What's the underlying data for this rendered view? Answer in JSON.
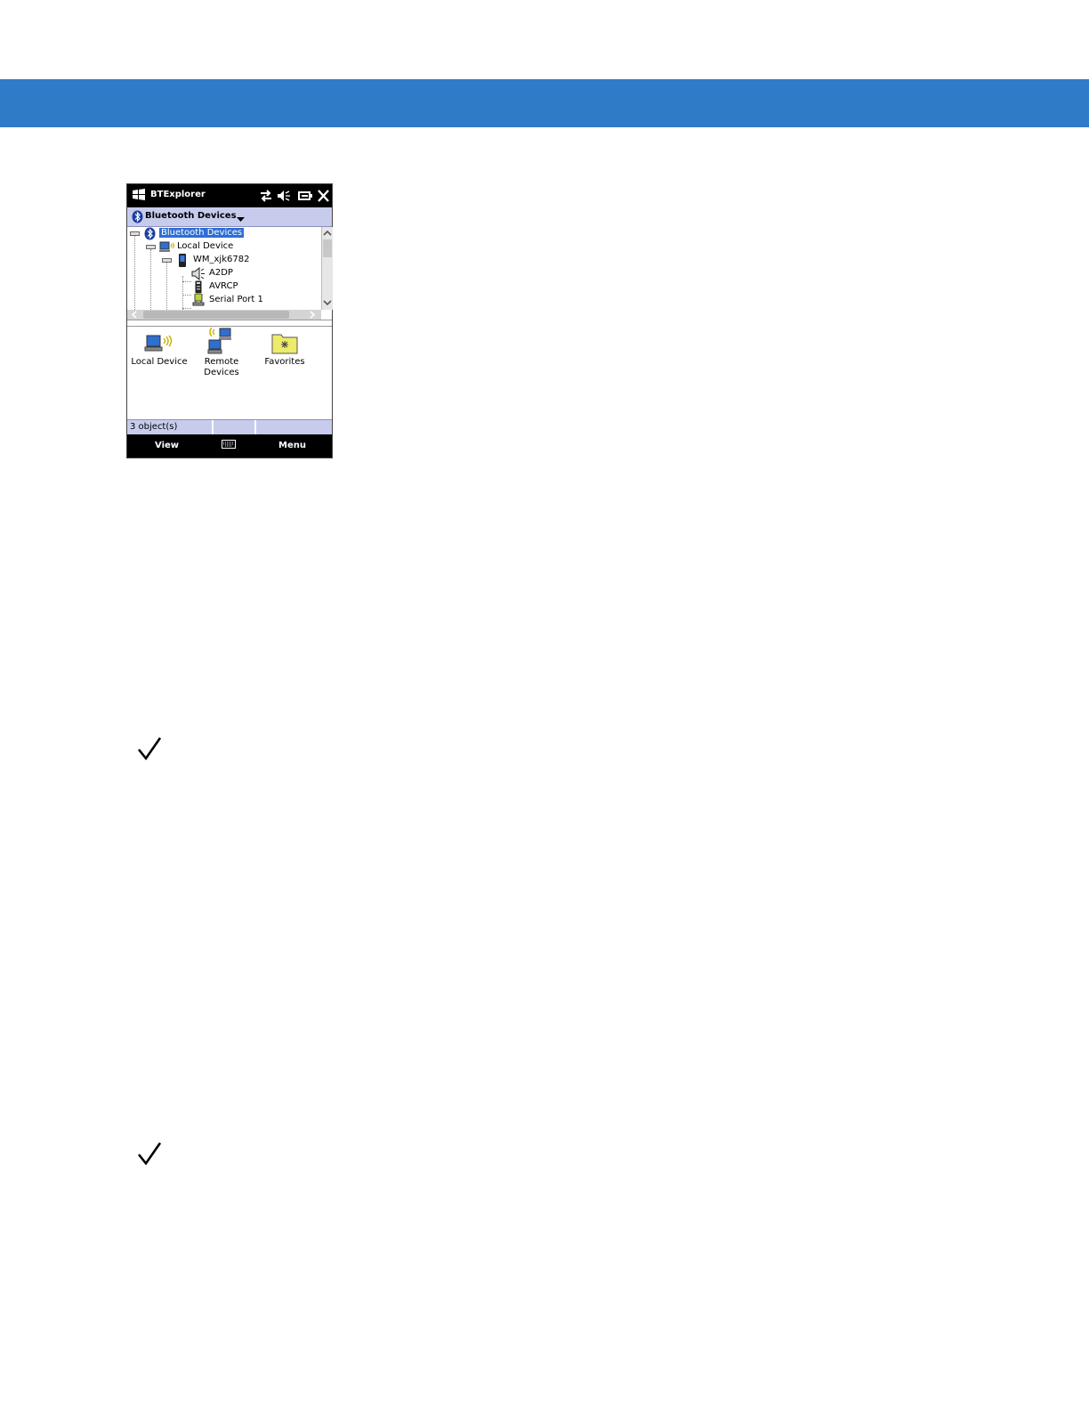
{
  "header_banner": {
    "color": "#2f7bc8"
  },
  "device_screen": {
    "titlebar": {
      "title": "BTExplorer",
      "icons": [
        "windows-start-icon",
        "connectivity-icon",
        "volume-icon",
        "battery-icon",
        "close-icon"
      ]
    },
    "navbar": {
      "label": "Bluetooth Devices",
      "icon": "bluetooth-icon",
      "dropdown_icon": "chevron-down-icon"
    },
    "tree": {
      "root": "Bluetooth Devices",
      "local_device": "Local Device",
      "device_name": "WM_xjk6782",
      "services": [
        {
          "label": "A2DP",
          "icon": "speaker-icon"
        },
        {
          "label": "AVRCP",
          "icon": "remote-control-icon"
        },
        {
          "label": "Serial Port 1",
          "icon": "serial-port-icon"
        }
      ]
    },
    "list_items": [
      {
        "label": "Local Device",
        "icon": "local-device-icon"
      },
      {
        "label": "Remote Devices",
        "icon": "remote-devices-icon"
      },
      {
        "label": "Favorites",
        "icon": "favorites-folder-icon"
      }
    ],
    "status": {
      "text": "3 object(s)"
    },
    "softkeys": {
      "left": "View",
      "center_icon": "keyboard-icon",
      "right": "Menu"
    }
  },
  "notes": [
    {
      "icon": "checkmark-icon"
    },
    {
      "icon": "checkmark-icon"
    }
  ]
}
